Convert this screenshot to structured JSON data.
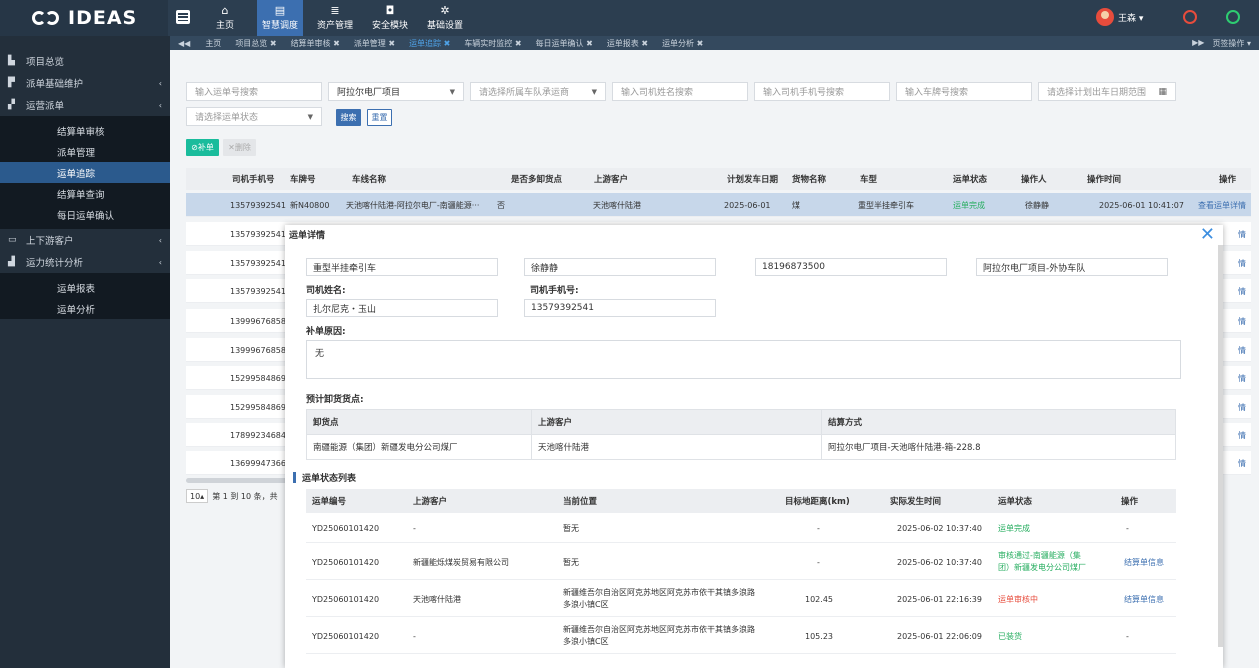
{
  "brand": {
    "logo_text": "IDEAS"
  },
  "topnav": [
    {
      "label": "主页",
      "icon": "home-icon",
      "glyph": "⌂"
    },
    {
      "label": "智慧调度",
      "icon": "document-icon",
      "glyph": "▤"
    },
    {
      "label": "资产管理",
      "icon": "database-icon",
      "glyph": "≣"
    },
    {
      "label": "安全模块",
      "icon": "shield-icon",
      "glyph": "◘"
    },
    {
      "label": "基础设置",
      "icon": "gear-icon",
      "glyph": "✲"
    }
  ],
  "user": {
    "name": "王森 ▾"
  },
  "tabs": {
    "items": [
      "主页",
      "项目总览 ✖",
      "结算单审核 ✖",
      "派单管理 ✖",
      "运单追踪 ✖",
      "车辆实时监控 ✖",
      "每日运单确认 ✖",
      "运单报表 ✖",
      "运单分析 ✖"
    ],
    "left_nav": "◀◀",
    "right_nav": "▶▶",
    "page_ops": "页签操作 ▾"
  },
  "sidebar": {
    "groups": [
      {
        "label": "项目总览",
        "icon": "chart-icon",
        "glyph": "▙",
        "arrow": ""
      },
      {
        "label": "派单基础维护",
        "icon": "truck-icon",
        "glyph": "▛",
        "arrow": "‹"
      },
      {
        "label": "运营派单",
        "icon": "car-icon",
        "glyph": "▞",
        "arrow": "‹"
      }
    ],
    "sub1": [
      "结算单审核",
      "派单管理",
      "运单追踪",
      "结算单查询",
      "每日运单确认"
    ],
    "groups2": [
      {
        "label": "上下游客户",
        "icon": "card-icon",
        "glyph": "▭",
        "arrow": "‹"
      },
      {
        "label": "运力统计分析",
        "icon": "bar-chart-icon",
        "glyph": "▟",
        "arrow": "‹"
      }
    ],
    "sub2": [
      "运单报表",
      "运单分析"
    ]
  },
  "filters": {
    "waybill_ph": "输入运单号搜索",
    "project": "阿拉尔电厂项目",
    "team_ph": "请选择所属车队承运商",
    "driver_ph": "输入司机姓名搜索",
    "phone_ph": "输入司机手机号搜索",
    "plate_ph": "输入车牌号搜索",
    "date_ph": "请选择计划出车日期范围",
    "status_ph": "请选择运单状态",
    "search_btn": "搜索",
    "reset_btn": "重置",
    "add_btn": "⊘补单",
    "del_btn": "✕删除"
  },
  "grid": {
    "columns": [
      "司机手机号",
      "车牌号",
      "车线名称",
      "是否多卸货点",
      "上游客户",
      "计划发车日期",
      "货物名称",
      "车型",
      "运单状态",
      "操作人",
      "操作时间",
      "操作"
    ],
    "first_row": {
      "phone": "13579392541",
      "plate": "新N40800",
      "route": "天池喀什陆港-阿拉尔电厂-南疆能源···",
      "multi": "否",
      "customer": "天池喀什陆港",
      "date": "2025-06-01",
      "goods": "煤",
      "type": "重型半挂牵引车",
      "status": "运单完成",
      "operator": "徐静静",
      "time": "2025-06-01 10:41:07",
      "op": "查看运单详情"
    },
    "phones": [
      "13579392541",
      "13579392541",
      "13579392541",
      "13999676858",
      "13999676858",
      "15299584869",
      "15299584869",
      "17899234684",
      "13699947366"
    ],
    "right_ops": [
      "情",
      "情",
      "情",
      "情",
      "情",
      "情",
      "情",
      "情",
      "情"
    ],
    "pager_size": "10▴",
    "pager_text": "第 1 到 10 条，共"
  },
  "modal": {
    "title": "运单详情",
    "vehicle_type": "重型半挂牵引车",
    "operator": "徐静静",
    "operator_phone": "18196873500",
    "team": "阿拉尔电厂项目-外协车队",
    "driver_label": "司机姓名:",
    "driver": "扎尔尼克・玉山",
    "driver_phone_label": "司机手机号:",
    "driver_phone": "13579392541",
    "reason_label": "补单原因:",
    "reason": "无",
    "unload_label": "预计卸货货点:",
    "unload_headers": [
      "卸货点",
      "上游客户",
      "结算方式"
    ],
    "unload_row": [
      "南疆能源（集团）新疆发电分公司煤厂",
      "天池喀什陆港",
      "阿拉尔电厂项目-天池喀什陆港-箱-228.8"
    ],
    "status_title": "运单状态列表",
    "status_headers": [
      "运单编号",
      "上游客户",
      "当前位置",
      "目标地距离(km)",
      "实际发生时间",
      "运单状态",
      "操作"
    ],
    "status_rows": [
      {
        "no": "YD25060101420",
        "cust": "-",
        "pos1": "暂无",
        "pos2": "",
        "dist": "-",
        "time": "2025-06-02 10:37:40",
        "status1": "运单完成",
        "status2": "",
        "color": "#27ae60",
        "op": "-"
      },
      {
        "no": "YD25060101420",
        "cust": "新疆能烁煤炭贸易有限公司",
        "pos1": "暂无",
        "pos2": "",
        "dist": "-",
        "time": "2025-06-02 10:37:40",
        "status1": "审核通过-南疆能源（集",
        "status2": "团）新疆发电分公司煤厂",
        "color": "#27ae60",
        "op": "结算单信息"
      },
      {
        "no": "YD25060101420",
        "cust": "天池喀什陆港",
        "pos1": "新疆维吾尔自治区阿克苏地区阿克苏市依干其镇多浪路",
        "pos2": "多浪小镇C区",
        "dist": "102.45",
        "time": "2025-06-01 22:16:39",
        "status1": "运单审核中",
        "status2": "",
        "color": "#e74c3c",
        "op": "结算单信息"
      },
      {
        "no": "YD25060101420",
        "cust": "-",
        "pos1": "新疆维吾尔自治区阿克苏地区阿克苏市依干其镇多浪路",
        "pos2": "多浪小镇C区",
        "dist": "105.23",
        "time": "2025-06-01 22:06:09",
        "status1": "已装货",
        "status2": "",
        "color": "#27ae60",
        "op": "-"
      }
    ]
  }
}
